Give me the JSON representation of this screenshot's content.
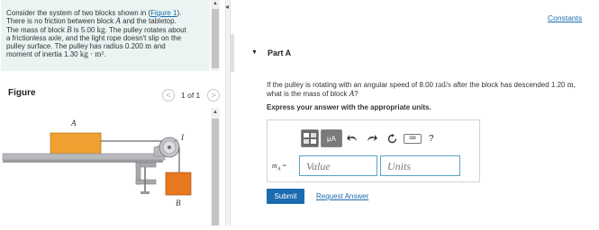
{
  "problem": {
    "line1_pre": "Consider the system of two blocks shown in (",
    "figure_link": "Figure 1",
    "line1_post": ").",
    "line2_pre": "There is no friction between block ",
    "block_a": "A",
    "line2_post": " and the tabletop.",
    "line3_pre": "The mass of block ",
    "block_b": "B",
    "line3_mid": " is 5.00 ",
    "mass_unit": "kg",
    "line3_post": ". The pulley rotates about",
    "line4": "a frictionless axle, and the light rope doesn't slip on the",
    "line5_pre": "pulley surface. The pulley has radius 0.200 ",
    "length_unit": "m",
    "line5_post": " and",
    "line6_pre": "moment of inertia 1.30 ",
    "inertia_unit": "kg · m²",
    "line6_post": "."
  },
  "figure": {
    "heading": "Figure",
    "prev_label": "<",
    "next_label": ">",
    "page_count": "1 of 1",
    "label_a": "A",
    "label_b": "B",
    "label_i": "I",
    "colors": {
      "block": "#f0a030",
      "block_b": "#e8781e",
      "table": "#a7a9ac",
      "rope": "#444444"
    }
  },
  "constants_link": "Constants",
  "part": {
    "caret": "▼",
    "title": "Part A"
  },
  "question": {
    "q1_pre": "If the pulley is rotating with an angular speed of 8.00 ",
    "q1_unit": "rad/s",
    "q1_post": " after the block has descended 1.20 ",
    "q1_unit2": "m",
    "q1_end": ",",
    "q2_pre": "what is the mass of block ",
    "q2_var": "A",
    "q2_post": "?"
  },
  "instruction": "Express your answer with the appropriate units.",
  "toolbar": {
    "mu_label": "μA",
    "undo_icon": "undo-icon",
    "redo_icon": "redo-icon",
    "reset_icon": "reset-icon",
    "keyboard_label": "⌨",
    "help_label": "?"
  },
  "answer": {
    "var_main": "m",
    "var_sub": "A",
    "var_eq": " =",
    "value_placeholder": "Value",
    "units_placeholder": "Units"
  },
  "buttons": {
    "submit": "Submit",
    "request_answer": "Request Answer"
  },
  "colors": {
    "accent": "#1a6bb0",
    "panel_bg": "#e9f4f3",
    "field_border": "#5aa3c9"
  }
}
